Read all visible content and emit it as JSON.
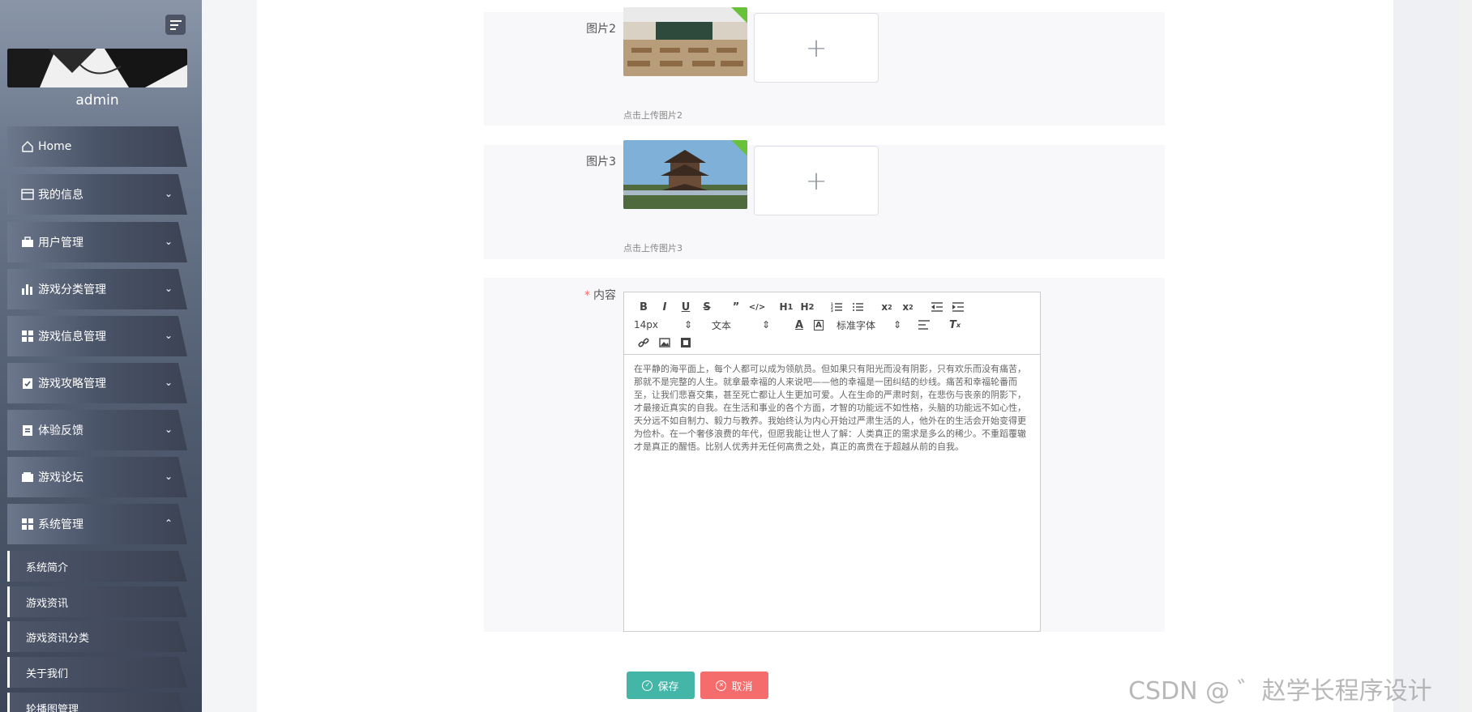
{
  "sidebar": {
    "username": "admin",
    "menu": [
      {
        "label": "Home",
        "icon": "home-icon"
      },
      {
        "label": "我的信息",
        "icon": "id-card-icon"
      },
      {
        "label": "用户管理",
        "icon": "briefcase-icon"
      },
      {
        "label": "游戏分类管理",
        "icon": "bar-chart-icon"
      },
      {
        "label": "游戏信息管理",
        "icon": "grid-icon"
      },
      {
        "label": "游戏攻略管理",
        "icon": "clipboard-check-icon"
      },
      {
        "label": "体验反馈",
        "icon": "clipboard-icon"
      },
      {
        "label": "游戏论坛",
        "icon": "wallet-icon"
      },
      {
        "label": "系统管理",
        "icon": "grid-icon"
      }
    ],
    "submenu": [
      {
        "label": "系统简介"
      },
      {
        "label": "游戏资讯"
      },
      {
        "label": "游戏资讯分类"
      },
      {
        "label": "关于我们"
      },
      {
        "label": "轮播图管理"
      }
    ]
  },
  "form": {
    "image2": {
      "label": "图片2",
      "hint": "点击上传图片2"
    },
    "image3": {
      "label": "图片3",
      "hint": "点击上传图片3"
    },
    "content": {
      "label": "内容",
      "required_mark": "*",
      "toolbar": {
        "font_size": "14px",
        "text_type": "文本",
        "font_family": "标准字体"
      },
      "body": "在平静的海平面上，每个人都可以成为领航员。但如果只有阳光而没有阴影，只有欢乐而没有痛苦，那就不是完整的人生。就拿最幸福的人来说吧——他的幸福是一团纠结的纱线。痛苦和幸福轮番而至，让我们悲喜交集，甚至死亡都让人生更加可爱。人在生命的严肃时刻，在悲伤与丧亲的阴影下，才最接近真实的自我。在生活和事业的各个方面，才智的功能远不如性格，头脑的功能远不如心性，天分远不如自制力、毅力与教养。我始终认为内心开始过严肃生活的人，他外在的生活会开始变得更为俭朴。在一个奢侈浪费的年代，但愿我能让世人了解：人类真正的需求是多么的稀少。不重蹈覆辙才是真正的醒悟。比别人优秀并无任何高贵之处，真正的高贵在于超越从前的自我。"
    }
  },
  "actions": {
    "save": "保存",
    "cancel": "取消"
  },
  "watermark": "CSDN @ ゛赵学长程序设计"
}
